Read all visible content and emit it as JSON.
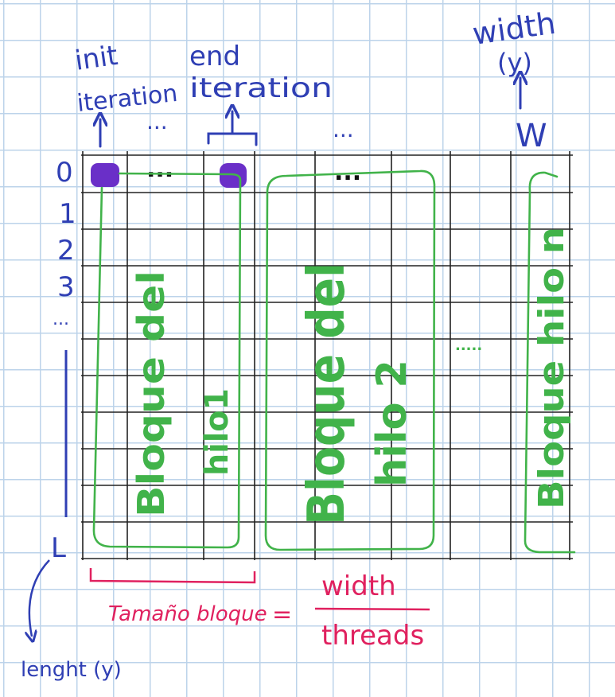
{
  "labels": {
    "init": "init",
    "init_iteration": "iteration",
    "end": "end",
    "end_iteration": "iteration",
    "width": "width",
    "width_var": "(y)",
    "w": "W",
    "top_dots_1": "...",
    "top_dots_2": "...",
    "length_end": "L",
    "length_var": "lenght (y)",
    "grid_dots_1": "...",
    "grid_dots_2": "...",
    "middle_dots": ".....",
    "row_dots": "..."
  },
  "rows": [
    "0",
    "1",
    "2",
    "3"
  ],
  "blocks": [
    {
      "line1": "Bloque del",
      "line2": "hilo1"
    },
    {
      "line1": "Bloque del",
      "line2": "hilo 2"
    },
    {
      "line1": "Bloque hilo n",
      "line2": ""
    }
  ],
  "formula": {
    "lhs": "Tamaño bloque",
    "equals": "=",
    "numerator": "width",
    "denominator": "threads"
  },
  "colors": {
    "blue": "#2f3fb4",
    "green": "#41b34a",
    "pink": "#e0215f",
    "purple": "#6a2fc8",
    "grid": "#222222",
    "paper_grid": "#bcd3ea"
  }
}
